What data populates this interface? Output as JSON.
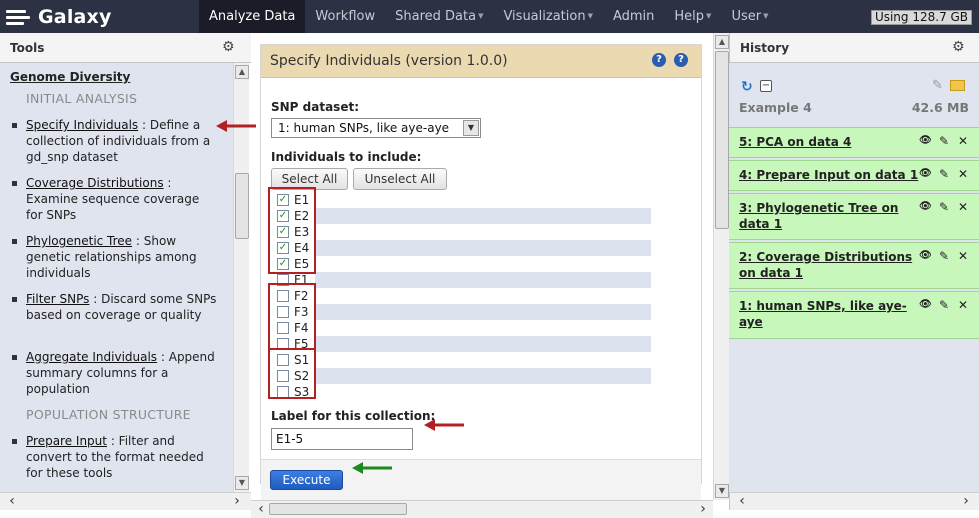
{
  "masthead": {
    "brand": "Galaxy",
    "nav": [
      {
        "label": "Analyze Data",
        "dropdown": false
      },
      {
        "label": "Workflow",
        "dropdown": false
      },
      {
        "label": "Shared Data",
        "dropdown": true
      },
      {
        "label": "Visualization",
        "dropdown": true
      },
      {
        "label": "Admin",
        "dropdown": false
      },
      {
        "label": "Help",
        "dropdown": true
      },
      {
        "label": "User",
        "dropdown": true
      }
    ],
    "quota": "Using 128.7 GB"
  },
  "tools": {
    "title": "Tools",
    "section": "Genome Diversity",
    "labels": [
      "INITIAL ANALYSIS",
      "POPULATION STRUCTURE"
    ],
    "items": [
      {
        "name": "Specify Individuals",
        "desc": " : Define a collection of individuals from a gd_snp dataset"
      },
      {
        "name": "Coverage Distributions",
        "desc": " : Examine sequence coverage for SNPs"
      },
      {
        "name": "Phylogenetic Tree",
        "desc": " : Show genetic relationships among individuals"
      },
      {
        "name": "Filter SNPs",
        "desc": " : Discard some SNPs based on coverage or quality"
      },
      {
        "name": "Aggregate Individuals",
        "desc": " : Append summary columns for a population"
      },
      {
        "name": "Prepare Input",
        "desc": " : Filter and convert to the format needed for these tools"
      }
    ]
  },
  "form": {
    "title": "Specify Individuals (version 1.0.0)",
    "snp_label": "SNP dataset:",
    "snp_value": "1: human SNPs, like aye-aye",
    "individuals_label": "Individuals to include:",
    "select_all": "Select All",
    "unselect_all": "Unselect All",
    "individuals": [
      {
        "name": "E1",
        "checked": true
      },
      {
        "name": "E2",
        "checked": true
      },
      {
        "name": "E3",
        "checked": true
      },
      {
        "name": "E4",
        "checked": true
      },
      {
        "name": "E5",
        "checked": true
      },
      {
        "name": "F1",
        "checked": false
      },
      {
        "name": "F2",
        "checked": false
      },
      {
        "name": "F3",
        "checked": false
      },
      {
        "name": "F4",
        "checked": false
      },
      {
        "name": "F5",
        "checked": false
      },
      {
        "name": "S1",
        "checked": false
      },
      {
        "name": "S2",
        "checked": false
      },
      {
        "name": "S3",
        "checked": false
      }
    ],
    "collection_label": "Label for this collection:",
    "collection_value": "E1-5",
    "execute": "Execute"
  },
  "history": {
    "title": "History",
    "name": "Example 4",
    "size": "42.6 MB",
    "items": [
      {
        "title": "5: PCA on data 4"
      },
      {
        "title": "4: Prepare Input on data 1"
      },
      {
        "title": "3: Phylogenetic Tree on data 1"
      },
      {
        "title": "2: Coverage Distributions on data 1"
      },
      {
        "title": "1: human SNPs, like aye-aye"
      }
    ]
  },
  "colors": {
    "masthead": "#2c3143",
    "panel_bg": "#e0e4ef",
    "form_title_bg": "#ebd9b2",
    "history_ok": "#c7f7ba",
    "execute": "#2a6ad0",
    "annotation_red": "#b22020",
    "annotation_green": "#1e8a1e"
  }
}
